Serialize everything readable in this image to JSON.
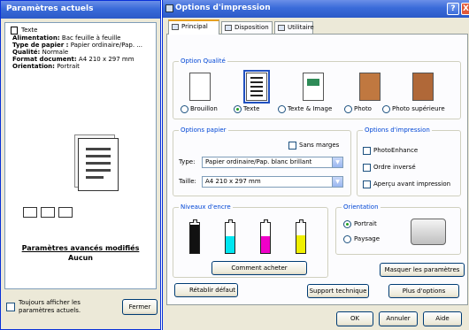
{
  "current_settings": {
    "title": "Paramètres actuels",
    "doc_type": "Texte",
    "rows": [
      {
        "label": "Alimentation:",
        "value": "Bac feuille à feuille"
      },
      {
        "label": "Type de papier :",
        "value": "Papier ordinaire/Pap. ..."
      },
      {
        "label": "Qualité:",
        "value": "Normale"
      },
      {
        "label": "Format document:",
        "value": "A4 210 x 297 mm"
      },
      {
        "label": "Orientation:",
        "value": "Portrait"
      }
    ],
    "advanced_label": "Paramètres avancés modifiés",
    "advanced_value": "Aucun",
    "always_show_label": "Toujours afficher les paramètres actuels.",
    "close_button": "Fermer"
  },
  "dialog": {
    "title": "Options d'impression",
    "help": "?",
    "close": "X",
    "tabs": [
      "Principal",
      "Disposition",
      "Utilitaire"
    ],
    "quality": {
      "title": "Option Qualité",
      "options": [
        "Brouillon",
        "Texte",
        "Texte & Image",
        "Photo",
        "Photo supérieure"
      ],
      "selected": "Texte"
    },
    "paper": {
      "title": "Options papier",
      "borderless": "Sans marges",
      "type_label": "Type:",
      "type_value": "Papier ordinaire/Pap. blanc brillant",
      "size_label": "Taille:",
      "size_value": "A4 210 x 297 mm"
    },
    "print_options": {
      "title": "Options d'impression",
      "items": [
        "PhotoEnhance",
        "Ordre inversé",
        "Aperçu avant impression"
      ]
    },
    "ink": {
      "title": "Niveaux d'encre",
      "cartridges": [
        {
          "color": "#111111",
          "level": 0.95
        },
        {
          "color": "#00e6f0",
          "level": 0.55
        },
        {
          "color": "#f000c8",
          "level": 0.55
        },
        {
          "color": "#f0f000",
          "level": 0.6
        }
      ],
      "buy_button": "Comment acheter"
    },
    "orientation": {
      "title": "Orientation",
      "options": [
        "Portrait",
        "Paysage"
      ],
      "selected": "Portrait"
    },
    "buttons": {
      "hide_settings": "Masquer les paramètres",
      "restore_defaults": "Rétablir défaut",
      "tech_support": "Support technique",
      "more_options": "Plus d'options",
      "ok": "OK",
      "cancel": "Annuler",
      "help": "Aide"
    }
  }
}
